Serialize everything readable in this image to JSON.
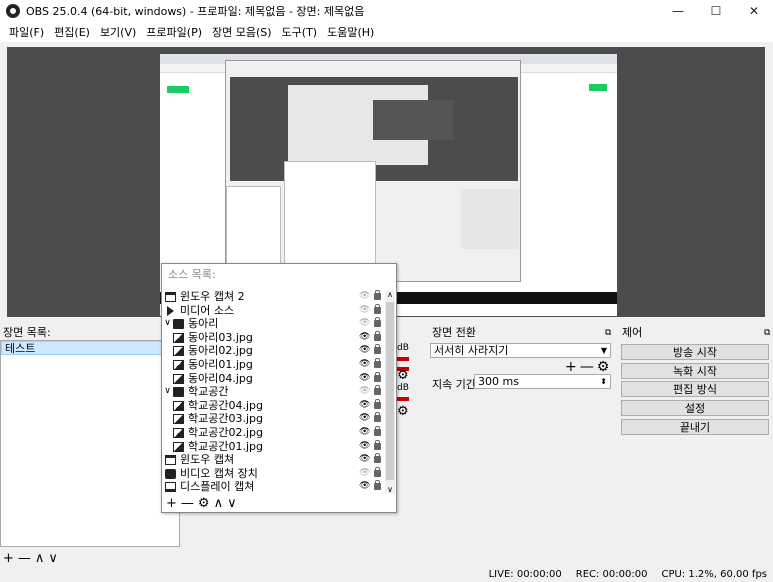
{
  "window": {
    "title": "OBS 25.0.4 (64-bit, windows) - 프로파일: 제목없음 - 장면: 제목없음",
    "minimize": "—",
    "maximize": "☐",
    "close": "✕"
  },
  "menu": [
    "파일(F)",
    "편집(E)",
    "보기(V)",
    "프로파일(P)",
    "장면 모음(S)",
    "도구(T)",
    "도움말(H)"
  ],
  "scenes": {
    "title": "장면 목록:",
    "items": [
      "테스트"
    ],
    "float_icon": "⧉",
    "toolbar": [
      "+",
      "—",
      "∧",
      "∨"
    ]
  },
  "sources": {
    "title": "소스 목록:",
    "items": [
      {
        "label": "윈도우 캡쳐 2",
        "icon": "window",
        "chev": "",
        "indent": 0,
        "visible": false
      },
      {
        "label": "미디어 소스",
        "icon": "play",
        "chev": "",
        "indent": 0,
        "visible": false
      },
      {
        "label": "동아리",
        "icon": "folder",
        "chev": "∨",
        "indent": 0,
        "visible": false
      },
      {
        "label": "동아리03.jpg",
        "icon": "image",
        "chev": "",
        "indent": 1,
        "visible": true
      },
      {
        "label": "동아리02.jpg",
        "icon": "image",
        "chev": "",
        "indent": 1,
        "visible": true
      },
      {
        "label": "동아리01.jpg",
        "icon": "image",
        "chev": "",
        "indent": 1,
        "visible": true
      },
      {
        "label": "동아리04.jpg",
        "icon": "image",
        "chev": "",
        "indent": 1,
        "visible": true
      },
      {
        "label": "학교공간",
        "icon": "folder",
        "chev": "∨",
        "indent": 0,
        "visible": false
      },
      {
        "label": "학교공간04.jpg",
        "icon": "image",
        "chev": "",
        "indent": 1,
        "visible": true
      },
      {
        "label": "학교공간03.jpg",
        "icon": "image",
        "chev": "",
        "indent": 1,
        "visible": true
      },
      {
        "label": "학교공간02.jpg",
        "icon": "image",
        "chev": "",
        "indent": 1,
        "visible": true
      },
      {
        "label": "학교공간01.jpg",
        "icon": "image",
        "chev": "",
        "indent": 1,
        "visible": true
      },
      {
        "label": "윈도우 캡쳐",
        "icon": "window",
        "chev": "",
        "indent": 0,
        "visible": true
      },
      {
        "label": "비디오 캡쳐 장치",
        "icon": "camera",
        "chev": "",
        "indent": 0,
        "visible": false
      },
      {
        "label": "디스플레이 캡쳐",
        "icon": "display",
        "chev": "",
        "indent": 0,
        "visible": true
      }
    ],
    "toolbar": [
      "+",
      "—",
      "⚙",
      "∧",
      "∨"
    ]
  },
  "mixer": {
    "db_label": "dB",
    "gear": "⚙"
  },
  "transitions": {
    "title": "장면 전환",
    "float_icon": "⧉",
    "selected": "서서히 사라지기",
    "add": "+",
    "remove": "—",
    "gear": "⚙",
    "duration_label": "지속 기간",
    "duration_value": "300 ms"
  },
  "controls": {
    "title": "제어",
    "float_icon": "⧉",
    "buttons": [
      "방송 시작",
      "녹화 시작",
      "편집 방식",
      "설정",
      "끝내기"
    ]
  },
  "status": {
    "live": "LIVE: 00:00:00",
    "rec": "REC: 00:00:00",
    "cpu": "CPU: 1.2%, 60.00 fps"
  },
  "colors": {
    "accent_select": "#cde8ff",
    "preview_bg": "#4c4c4c"
  }
}
